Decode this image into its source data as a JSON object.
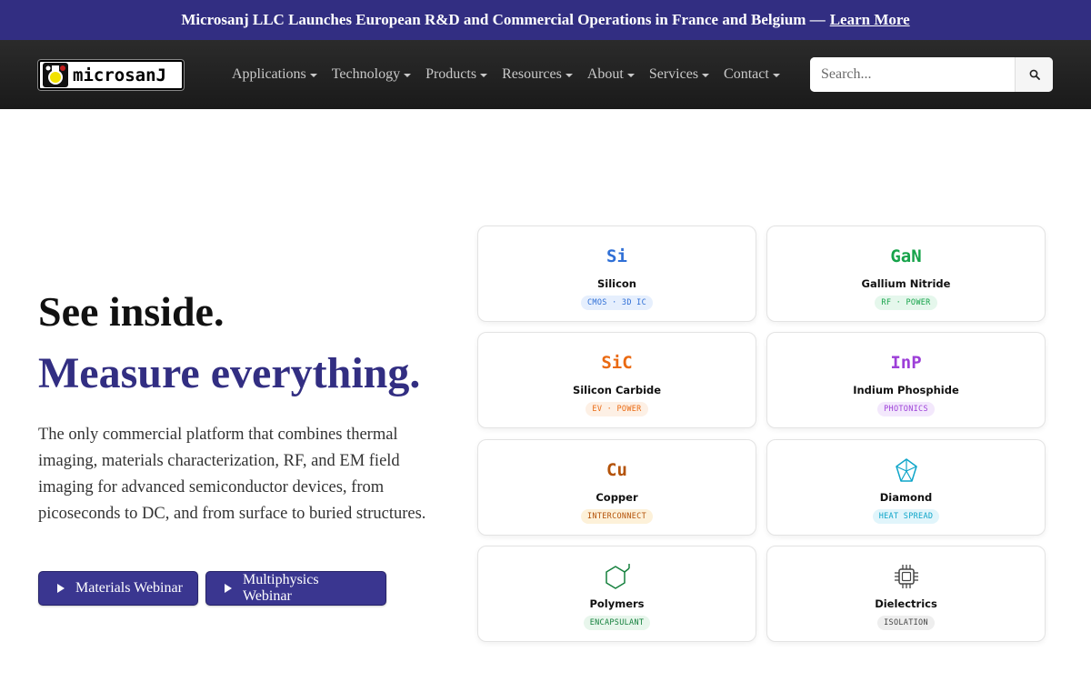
{
  "announcement": {
    "text": "Microsanj LLC Launches European R&D and Commercial Operations in France and Belgium —",
    "link": "Learn More"
  },
  "navbar": {
    "logo_text": "microsanJ",
    "menu": [
      {
        "label": "Applications"
      },
      {
        "label": "Technology"
      },
      {
        "label": "Products"
      },
      {
        "label": "Resources"
      },
      {
        "label": "About"
      },
      {
        "label": "Services"
      },
      {
        "label": "Contact"
      }
    ],
    "search": {
      "placeholder": "Search...",
      "icon": "search-icon"
    }
  },
  "hero": {
    "title_line1": "See inside.",
    "title_line2": "Measure everything.",
    "description": "The only commercial platform that combines thermal imaging, materials characterization, RF, and EM field imaging for advanced semiconductor devices, from picoseconds to DC, and from surface to buried structures.",
    "buttons": [
      {
        "label": "Materials Webinar",
        "icon": "play-icon"
      },
      {
        "label": "Multiphysics Webinar",
        "icon": "play-icon"
      }
    ]
  },
  "materials": [
    {
      "symbol": "Si",
      "name": "Silicon",
      "tag": "CMOS · 3D IC",
      "color": "#2f6fd6",
      "tag_bg": "#e6effd"
    },
    {
      "symbol": "GaN",
      "name": "Gallium Nitride",
      "tag": "RF · POWER",
      "color": "#16a34a",
      "tag_bg": "#e5f7ec"
    },
    {
      "symbol": "SiC",
      "name": "Silicon Carbide",
      "tag": "EV · POWER",
      "color": "#ea6a12",
      "tag_bg": "#fdf0e5"
    },
    {
      "symbol": "InP",
      "name": "Indium Phosphide",
      "tag": "PHOTONICS",
      "color": "#9d3fd8",
      "tag_bg": "#f3e8fc"
    },
    {
      "symbol": "Cu",
      "name": "Copper",
      "tag": "INTERCONNECT",
      "color": "#b45309",
      "tag_bg": "#fdf1d9"
    },
    {
      "symbol": "",
      "icon": "diamond-icon",
      "name": "Diamond",
      "tag": "HEAT SPREAD",
      "color": "#0ea5c9",
      "tag_bg": "#e1f5fb"
    },
    {
      "symbol": "",
      "icon": "polymer-hexagon-icon",
      "name": "Polymers",
      "tag": "ENCAPSULANT",
      "color": "#15803d",
      "tag_bg": "#e8f6ec"
    },
    {
      "symbol": "",
      "icon": "chip-icon",
      "name": "Dielectrics",
      "tag": "ISOLATION",
      "color": "#444444",
      "tag_bg": "#eeeeee"
    }
  ]
}
